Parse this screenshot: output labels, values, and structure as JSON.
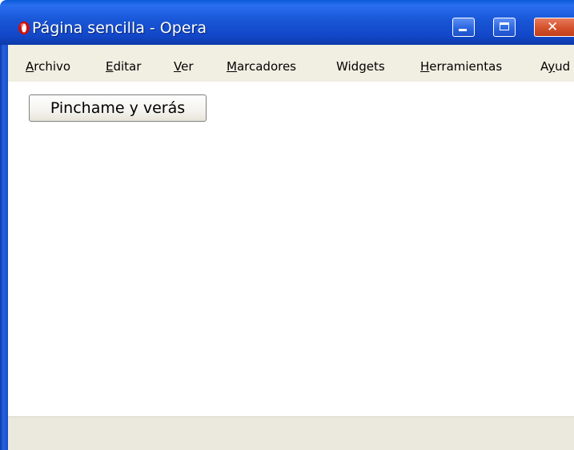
{
  "window": {
    "title": "Página sencilla - Opera",
    "close_glyph": "✕"
  },
  "menu": {
    "items": [
      {
        "mnemonic": "A",
        "rest": "rchivo"
      },
      {
        "mnemonic": "E",
        "rest": "ditar"
      },
      {
        "mnemonic": "V",
        "rest": "er"
      },
      {
        "mnemonic": "M",
        "rest": "arcadores"
      },
      {
        "pre": "Widgets"
      },
      {
        "mnemonic": "H",
        "rest": "erramientas"
      },
      {
        "pre": "A",
        "mnemonic": "y",
        "rest": "ud"
      }
    ]
  },
  "content": {
    "button_label": "Pinchame y verás"
  },
  "icons": {
    "app": "opera-logo-icon",
    "minimize": "minimize-icon",
    "maximize": "maximize-icon",
    "close": "close-icon"
  },
  "colors": {
    "titlebar": "#1856d6",
    "close_button": "#d4512c",
    "menubar": "#f1efe2",
    "opera_red": "#cc1010"
  }
}
